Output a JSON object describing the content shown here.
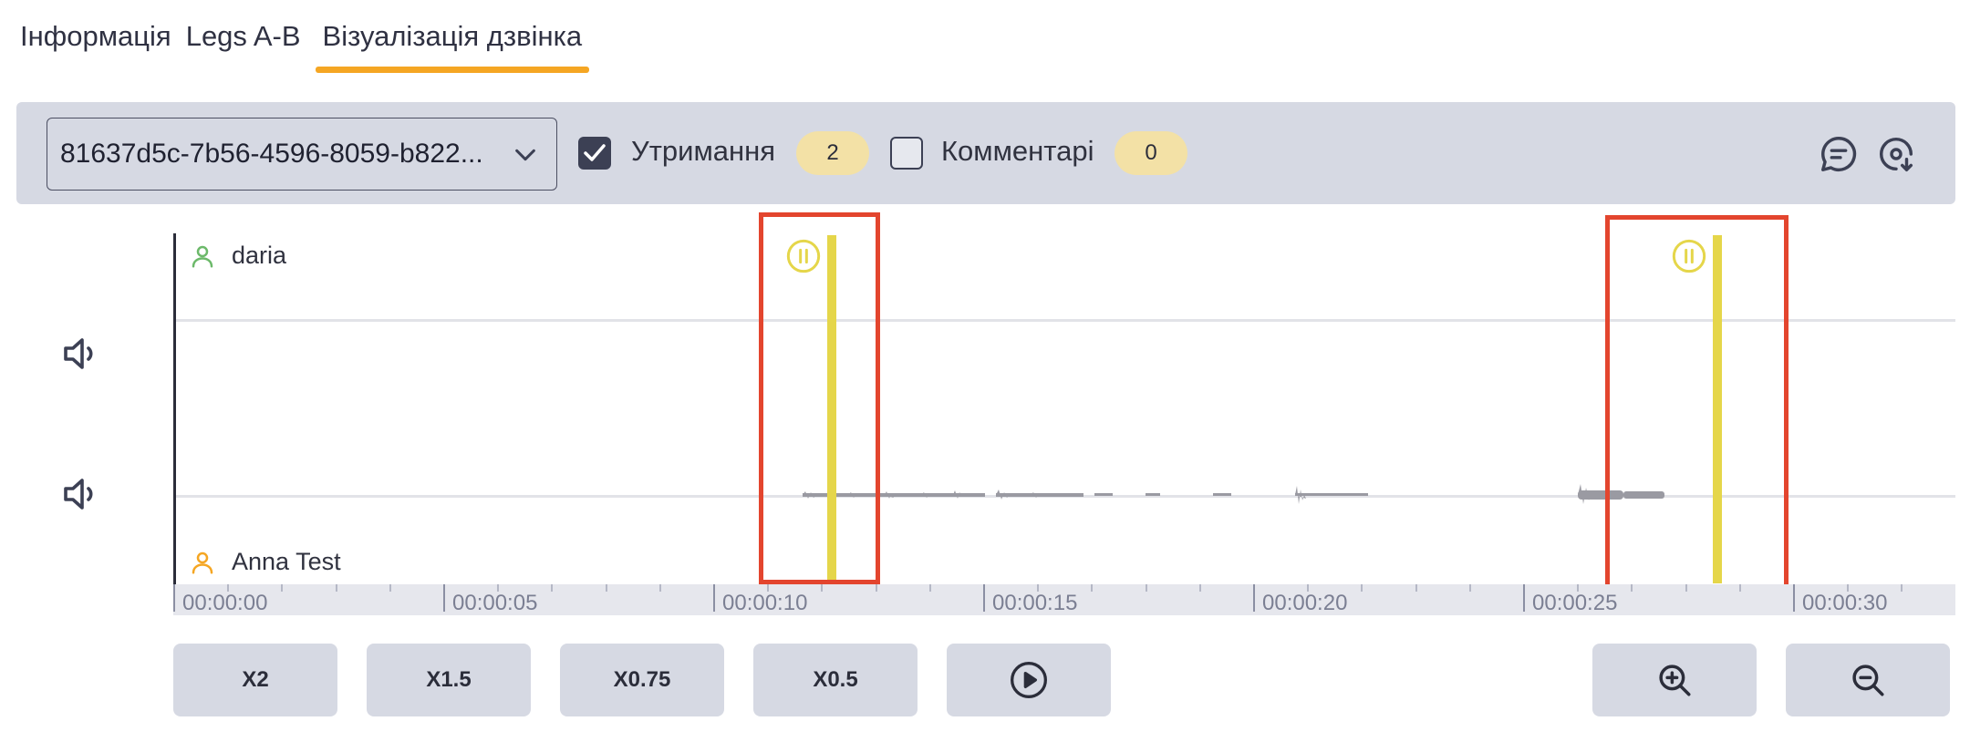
{
  "tabs": [
    {
      "label": "Інформація",
      "active": false
    },
    {
      "label": "Legs A-B",
      "active": false
    },
    {
      "label": "Візуалізація дзвінка",
      "active": true
    }
  ],
  "toolbar": {
    "call_id": "81637d5c-7b56-4596-8059-b822...",
    "holds_label": "Утримання",
    "holds_checked": true,
    "holds_count": "2",
    "comments_label": "Комментарі",
    "comments_checked": false,
    "comments_count": "0",
    "icons": [
      "comment-icon",
      "download-icon"
    ]
  },
  "tracks": [
    {
      "name": "daria",
      "icon": "person-icon",
      "color": "#6cb96a"
    },
    {
      "name": "Anna Test",
      "icon": "person-icon",
      "color": "#f5a623"
    }
  ],
  "timeline": {
    "labels": [
      "00:00:00",
      "00:00:05",
      "00:00:10",
      "00:00:15",
      "00:00:20",
      "00:00:25",
      "00:00:30"
    ]
  },
  "holds": [
    {
      "time_seconds": 12.2
    },
    {
      "time_seconds": 28.6
    }
  ],
  "controls": {
    "speeds": [
      "X2",
      "X1.5",
      "X0.75",
      "X0.5"
    ],
    "icons": [
      "play-icon",
      "zoom-in-icon",
      "zoom-out-icon"
    ]
  },
  "colors": {
    "accent": "#f5a623",
    "hold": "#e5d64a",
    "highlight": "#e3452e"
  }
}
